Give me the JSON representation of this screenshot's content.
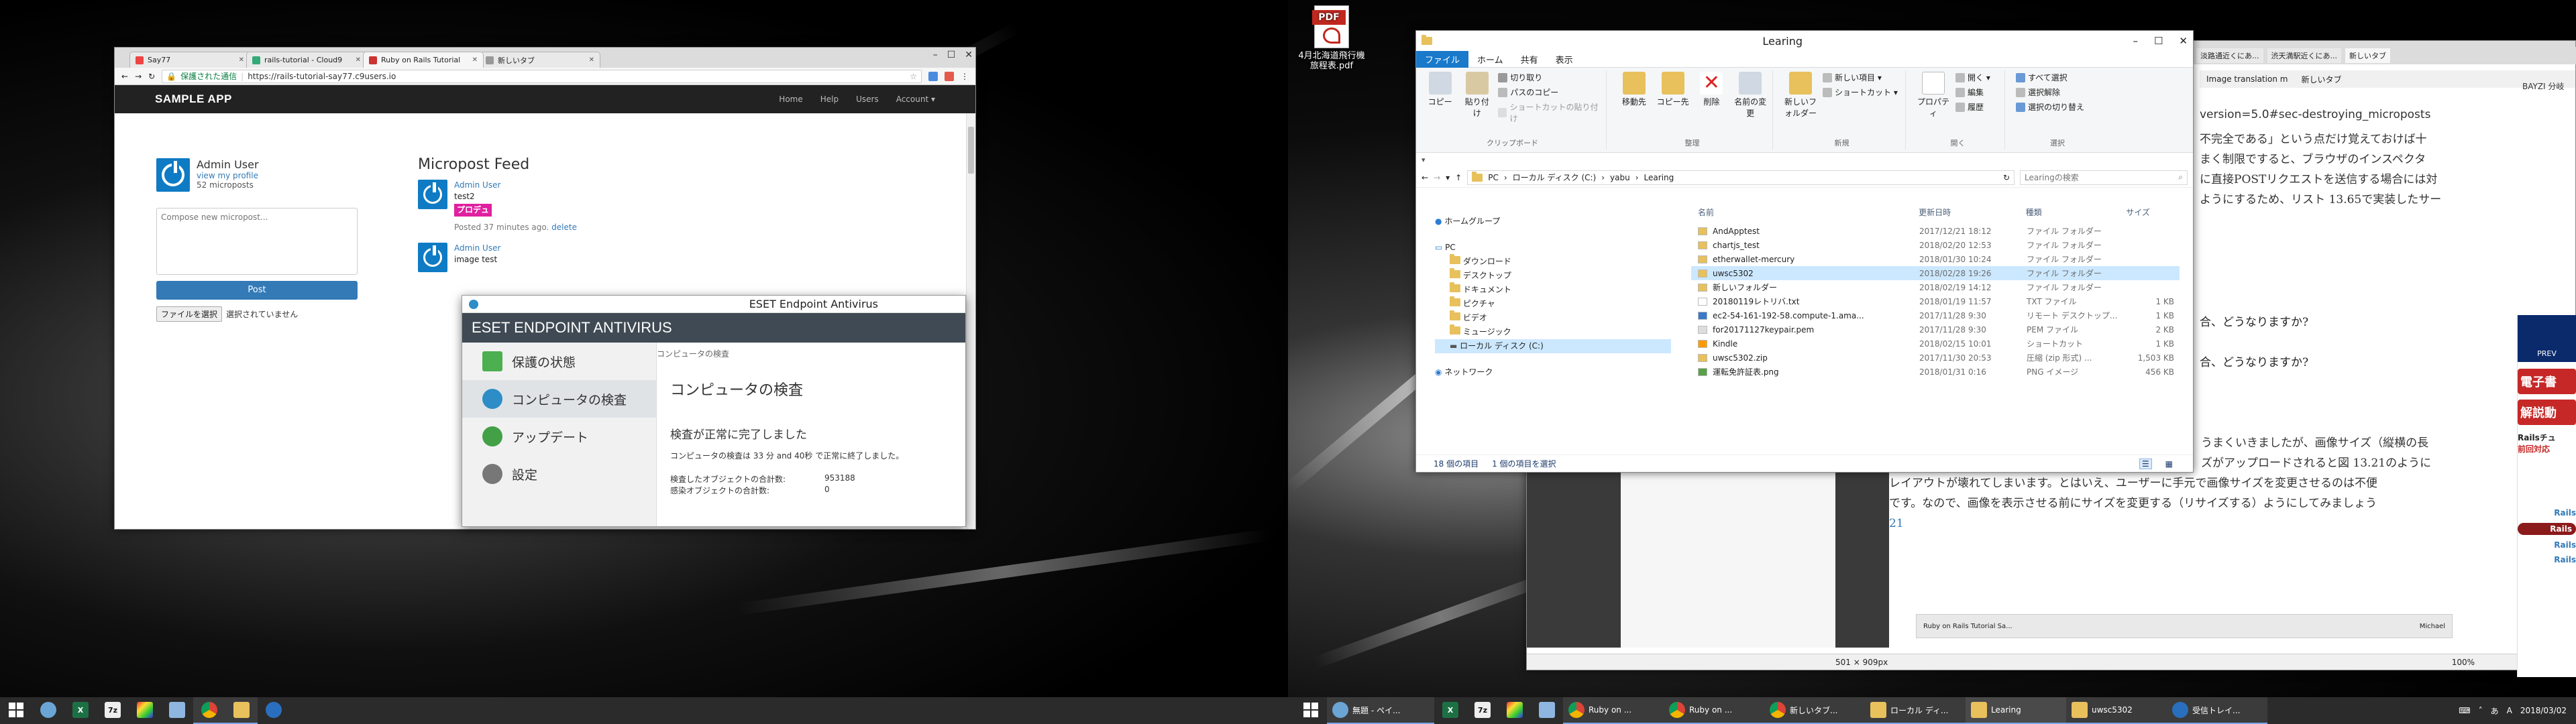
{
  "browser": {
    "tabs": [
      {
        "label": "Say77",
        "color": "#e44"
      },
      {
        "label": "rails-tutorial - Cloud9",
        "color": "#3a7"
      },
      {
        "label": "Ruby on Rails Tutorial",
        "color": "#c33"
      },
      {
        "label": "新しいタブ",
        "color": "#999"
      }
    ],
    "secure_label": "保護された通信",
    "url": "https://rails-tutorial-say77.c9users.io"
  },
  "app": {
    "brand": "SAMPLE APP",
    "nav": [
      "Home",
      "Help",
      "Users",
      "Account ▾"
    ],
    "user_name": "Admin User",
    "view_profile": "view my profile",
    "micropost_count": "52 microposts",
    "compose_placeholder": "Compose new micropost...",
    "post_button": "Post",
    "file_button": "ファイルを選択",
    "file_status": "選択されていません",
    "feed_title": "Micropost Feed",
    "posts": [
      {
        "author": "Admin User",
        "content": "test2",
        "badge": "プロデュ",
        "meta": "Posted 37 minutes ago.",
        "action": "delete"
      },
      {
        "author": "Admin User",
        "content": "image test",
        "badge": "",
        "meta": "",
        "action": ""
      }
    ]
  },
  "eset": {
    "window_title": "ESET Endpoint Antivirus",
    "header": "ESET ENDPOINT ANTIVIRUS",
    "menu": [
      "保護の状態",
      "コンピュータの検査",
      "アップデート",
      "設定"
    ],
    "breadcrumb": "コンピュータの検査",
    "heading": "コンピュータの検査",
    "status": "検査が正常に完了しました",
    "detail": "コンピュータの検査は 33 分 and 40秒 で正常に終了しました。",
    "objects_label": "検査したオブジェクトの合計数:",
    "objects_value": "953188",
    "infected_label": "感染オブジェクトの合計数:",
    "infected_value": "0"
  },
  "desktop_icon": {
    "label": "4月北海道飛行機\n旅程表.pdf"
  },
  "explorer": {
    "title": "Learing",
    "ribbon_tabs": [
      "ファイル",
      "ホーム",
      "共有",
      "表示"
    ],
    "ribbon": {
      "clipboard": {
        "big": [
          "コピー",
          "貼り付け"
        ],
        "small": [
          "切り取り",
          "パスのコピー",
          "ショートカットの貼り付け"
        ],
        "label": "クリップボード"
      },
      "organize": {
        "big": [
          "移動先",
          "コピー先",
          "削除",
          "名前の変更"
        ],
        "label": "整理"
      },
      "new": {
        "big": [
          "新しいフォルダー"
        ],
        "small": [
          "新しい項目 ▾",
          "ショートカット ▾"
        ],
        "label": "新規"
      },
      "open": {
        "big": [
          "プロパティ"
        ],
        "small": [
          "開く ▾",
          "編集",
          "履歴"
        ],
        "label": "開く"
      },
      "select": {
        "small": [
          "すべて選択",
          "選択解除",
          "選択の切り替え"
        ],
        "label": "選択"
      }
    },
    "path": [
      "PC",
      "ローカル ディスク (C:)",
      "yabu",
      "Learing"
    ],
    "search_placeholder": "Learingの検索",
    "columns": [
      "名前",
      "更新日時",
      "種類",
      "サイズ"
    ],
    "nav": [
      "ホームグループ",
      "PC",
      "ダウンロード",
      "デスクトップ",
      "ドキュメント",
      "ピクチャ",
      "ビデオ",
      "ミュージック",
      "ローカル ディスク (C:)",
      "ネットワーク"
    ],
    "rows": [
      {
        "name": "AndApptest",
        "date": "2017/12/21 18:12",
        "type": "ファイル フォルダー",
        "size": "",
        "kind": "folder"
      },
      {
        "name": "chartjs_test",
        "date": "2018/02/20 12:53",
        "type": "ファイル フォルダー",
        "size": "",
        "kind": "folder"
      },
      {
        "name": "etherwallet-mercury",
        "date": "2018/01/30 10:24",
        "type": "ファイル フォルダー",
        "size": "",
        "kind": "folder"
      },
      {
        "name": "uwsc5302",
        "date": "2018/02/28 19:26",
        "type": "ファイル フォルダー",
        "size": "",
        "kind": "folder"
      },
      {
        "name": "新しいフォルダー",
        "date": "2018/02/19 14:12",
        "type": "ファイル フォルダー",
        "size": "",
        "kind": "folder"
      },
      {
        "name": "20180119レトリバ.txt",
        "date": "2018/01/19 11:57",
        "type": "TXT ファイル",
        "size": "1 KB",
        "kind": "txt"
      },
      {
        "name": "ec2-54-161-192-58.compute-1.ama...",
        "date": "2017/11/28 9:30",
        "type": "リモート デスクトップ...",
        "size": "1 KB",
        "kind": "rdp"
      },
      {
        "name": "for20171127keypair.pem",
        "date": "2017/11/28 9:30",
        "type": "PEM ファイル",
        "size": "2 KB",
        "kind": "file"
      },
      {
        "name": "Kindle",
        "date": "2018/02/15 10:01",
        "type": "ショートカット",
        "size": "1 KB",
        "kind": "link"
      },
      {
        "name": "uwsc5302.zip",
        "date": "2017/11/30 20:53",
        "type": "圧縮 (zip 形式) ...",
        "size": "1,503 KB",
        "kind": "zip"
      },
      {
        "name": "運転免許証表.png",
        "date": "2018/01/31 0:16",
        "type": "PNG イメージ",
        "size": "456 KB",
        "kind": "png"
      }
    ],
    "status_count": "18 個の項目",
    "status_selected": "1 個の項目を選択"
  },
  "right_browser": {
    "tabs": [
      "Image translation m",
      "新しいタブ"
    ],
    "top_tabs": [
      "淡路通近くにあ...",
      "渋天満駅近くにあ...",
      "新しいタブ",
      "BAYZI 分岐"
    ],
    "url_fragment": "version=5.0#sec-destroying_microposts",
    "lines": [
      "不完全である」という点だけ覚えておけば十",
      "まく制限ですると、ブラウザのインスペクタ",
      "に直接POSTリクエストを送信する場合には対",
      "ようにするため、リスト 13.65で実装したサー"
    ],
    "q1": "合、どうなりますか?",
    "q2": "合、どうなりますか?",
    "para": [
      "うまくいきましたが、画像サイズ（縦横の長",
      "ズがアップロードされると図 13.21のように",
      "レイアウトが壊れてしまいます。とはいえ、ユーザーに手元で画像サイズを変更させるのは不便",
      "です。なので、画像を表示させる前にサイズを変更する（リサイズする）ようにしてみましょう",
      "21"
    ],
    "side_labels": [
      "電子書",
      "解説動",
      "Railsチュ",
      "前回対応",
      "Rails",
      "Rails",
      "Rails",
      "Rails"
    ],
    "prev": "PREV",
    "zoom": "100%",
    "img_size": "501 × 909px",
    "mini_tab": "Ruby on Rails Tutorial Sa...",
    "mini_user": "Michael"
  },
  "taskbar_left": {
    "apps": [
      {
        "name": "start",
        "label": ""
      },
      {
        "name": "paint",
        "label": ""
      },
      {
        "name": "excel",
        "label": "X"
      },
      {
        "name": "7zip",
        "label": "7z"
      },
      {
        "name": "sniptool",
        "label": ""
      },
      {
        "name": "notepad",
        "label": ""
      },
      {
        "name": "chrome",
        "label": ""
      },
      {
        "name": "explorer",
        "label": ""
      },
      {
        "name": "thunderbird",
        "label": ""
      }
    ]
  },
  "taskbar_right": {
    "items": [
      {
        "label": "無題 - ペイ...",
        "kind": "paint"
      },
      {
        "label": "",
        "kind": "excel"
      },
      {
        "label": "",
        "kind": "7zip"
      },
      {
        "label": "",
        "kind": "sniptool"
      },
      {
        "label": "",
        "kind": "notepad"
      },
      {
        "label": "Ruby on ...",
        "kind": "chrome"
      },
      {
        "label": "Ruby on ...",
        "kind": "chrome"
      },
      {
        "label": "新しいタブ...",
        "kind": "chrome"
      },
      {
        "label": "ローカル ディ...",
        "kind": "explorer"
      },
      {
        "label": "Learing",
        "kind": "explorer"
      },
      {
        "label": "uwsc5302",
        "kind": "explorer"
      },
      {
        "label": "受信トレイ...",
        "kind": "thunderbird"
      }
    ],
    "date": "2018/03/02",
    "lang": "A",
    "ime": "あ"
  }
}
